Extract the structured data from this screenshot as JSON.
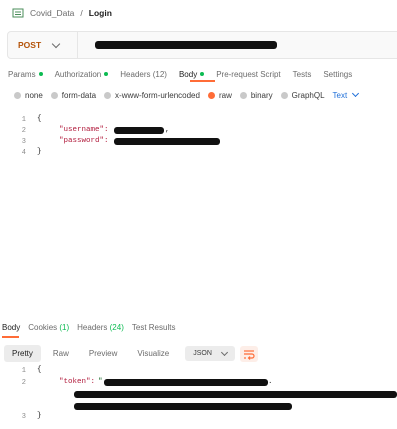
{
  "breadcrumb": {
    "collection": "Covid_Data",
    "separator": "/",
    "request": "Login"
  },
  "request": {
    "method": "POST"
  },
  "request_tabs": [
    {
      "label": "Params",
      "dot": true
    },
    {
      "label": "Authorization",
      "dot": true
    },
    {
      "label": "Headers (12)",
      "dot": false
    },
    {
      "label": "Body",
      "dot": true,
      "active": true
    },
    {
      "label": "Pre-request Script",
      "dot": false
    },
    {
      "label": "Tests",
      "dot": false
    },
    {
      "label": "Settings",
      "dot": false
    }
  ],
  "body_types": [
    "none",
    "form-data",
    "x-www-form-urlencoded",
    "raw",
    "binary",
    "GraphQL"
  ],
  "body_type_selected": "raw",
  "body_format": "Text",
  "request_body": {
    "line_numbers": [
      "1",
      "2",
      "3",
      "4"
    ],
    "open_brace": "{",
    "close_brace": "}",
    "key_username": "\"username\":",
    "key_password": "\"password\":",
    "comma": ","
  },
  "response_tabs": {
    "body": "Body",
    "cookies": "Cookies",
    "cookies_count": "(1)",
    "headers": "Headers",
    "headers_count": "(24)",
    "test_results": "Test Results"
  },
  "view_modes": [
    "Pretty",
    "Raw",
    "Preview",
    "Visualize"
  ],
  "response_format": "JSON",
  "response_body": {
    "line_numbers": [
      "1",
      "2",
      "3"
    ],
    "open_brace": "{",
    "close_brace": "}",
    "key_token": "\"token\":",
    "quote": "\"",
    "dot": "."
  },
  "colors": {
    "accent": "#ff6c37",
    "status_green": "#0cbb52",
    "method": "#b45309",
    "link": "#1e6fd9"
  }
}
